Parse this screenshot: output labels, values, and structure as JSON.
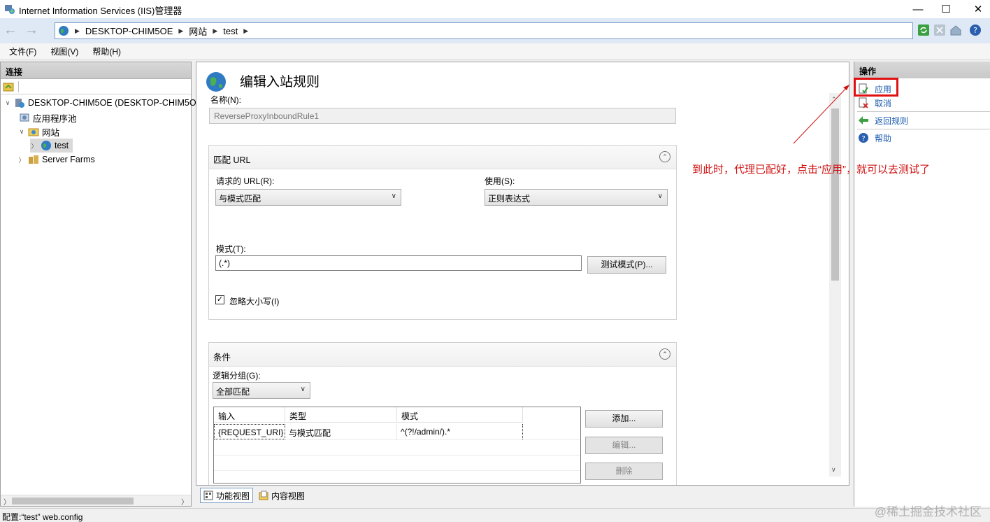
{
  "window": {
    "title": "Internet Information Services (IIS)管理器"
  },
  "address": {
    "crumbs": [
      "DESKTOP-CHIM5OE",
      "网站",
      "test"
    ]
  },
  "menu": {
    "items": [
      "文件(F)",
      "视图(V)",
      "帮助(H)"
    ]
  },
  "connections": {
    "header": "连接",
    "tree": [
      {
        "label": "DESKTOP-CHIM5OE (DESKTOP-CHIM5O",
        "icon": "server-icon"
      },
      {
        "label": "应用程序池",
        "icon": "app-pool-icon"
      },
      {
        "label": "网站",
        "icon": "sites-folder-icon"
      },
      {
        "label": "test",
        "icon": "globe-icon"
      },
      {
        "label": "Server Farms",
        "icon": "server-farms-icon"
      }
    ]
  },
  "editor": {
    "title": "编辑入站规则",
    "name_label": "名称(N):",
    "name_value": "ReverseProxyInboundRule1",
    "match_url": {
      "title": "匹配 URL",
      "requested_url_label": "请求的 URL(R):",
      "requested_url_value": "与模式匹配",
      "using_label": "使用(S):",
      "using_value": "正则表达式",
      "pattern_label": "模式(T):",
      "pattern_value": "(.*)",
      "test_button": "测试模式(P)...",
      "ignore_case_label": "忽略大小写(I)",
      "ignore_case_checked": true
    },
    "conditions": {
      "title": "条件",
      "grouping_label": "逻辑分组(G):",
      "grouping_value": "全部匹配",
      "columns": [
        "输入",
        "类型",
        "模式"
      ],
      "rows": [
        {
          "input": "{REQUEST_URI}",
          "type": "与模式匹配",
          "pattern": "^(?!/admin/).*"
        }
      ],
      "add_button": "添加...",
      "edit_button": "编辑...",
      "delete_button": "删除"
    }
  },
  "bottom_tabs": [
    "功能视图",
    "内容视图"
  ],
  "actions": {
    "header": "操作",
    "items": [
      {
        "label": "应用",
        "icon": "apply-icon"
      },
      {
        "label": "取消",
        "icon": "cancel-icon"
      },
      {
        "label": "返回规则",
        "icon": "back-arrow-icon"
      },
      {
        "label": "帮助",
        "icon": "help-icon"
      }
    ]
  },
  "annotation": "到此时，代理已配好，点击“应用”，就可以去测试了",
  "status": "配置:“test” web.config",
  "watermark": "@稀土掘金技术社区",
  "colors": {
    "accent": "#1c5cb0",
    "annotation": "#d01010",
    "highlight_border": "#e01010"
  }
}
